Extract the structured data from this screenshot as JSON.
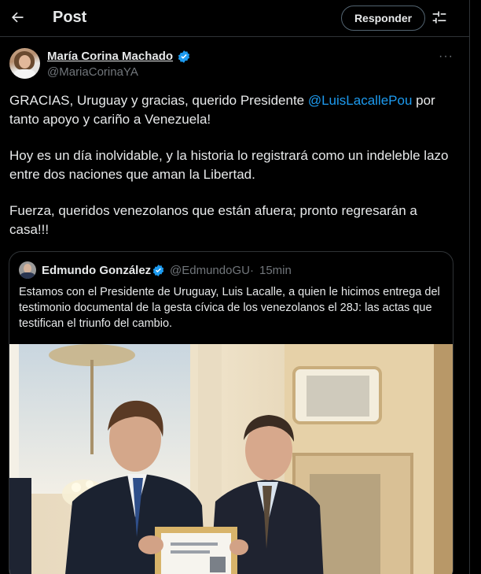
{
  "header": {
    "title": "Post",
    "reply_label": "Responder",
    "back_icon": "arrow-left-icon",
    "settings_icon": "tune-icon"
  },
  "tweet": {
    "author_name": "María Corina Machado",
    "author_handle": "@MariaCorinaYA",
    "more_label": "···",
    "text_line1_pre": "GRACIAS, Uruguay y gracias, querido Presidente ",
    "text_line1_mention": "@LuisLacallePou",
    "text_line1_post": " por tanto apoyo y cariño a Venezuela!",
    "text_para2": "Hoy es un día inolvidable, y la historia lo registrará como un indeleble lazo entre dos naciones que aman la Libertad.",
    "text_para3": "Fuerza, queridos venezolanos que están afuera; pronto regresarán a casa!!!"
  },
  "quote": {
    "author_name": "Edmundo González",
    "author_handle": "@EdmundoGU",
    "separator": "·",
    "time": "15min",
    "text": "Estamos con el Presidente de Uruguay, Luis Lacalle, a quien le hicimos entrega del testimonio documental de la gesta cívica de los venezolanos el 28J: las actas que testifican el triunfo del cambio."
  },
  "colors": {
    "background": "#000000",
    "text": "#e7e9ea",
    "muted": "#71767b",
    "accent": "#1d9bf0",
    "border": "#2f3336"
  }
}
